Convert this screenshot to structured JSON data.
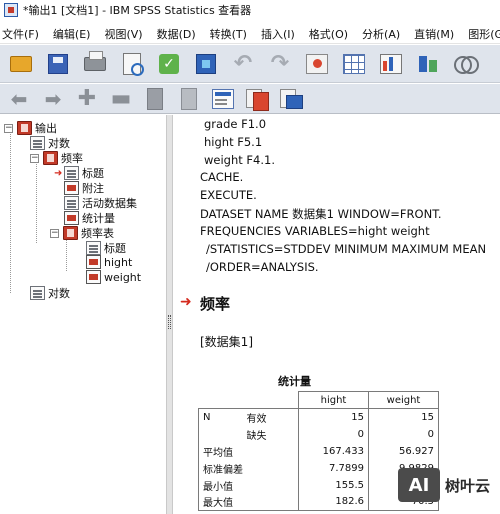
{
  "window": {
    "title": "*输出1 [文档1] - IBM SPSS Statistics 查看器"
  },
  "menu": [
    "文件(F)",
    "编辑(E)",
    "视图(V)",
    "数据(D)",
    "转换(T)",
    "插入(I)",
    "格式(O)",
    "分析(A)",
    "直销(M)",
    "图形(G)"
  ],
  "toolbar1": [
    {
      "name": "open-icon"
    },
    {
      "name": "save-icon"
    },
    {
      "name": "print-icon"
    },
    {
      "name": "print-preview-icon"
    },
    {
      "name": "recall-dialog-icon"
    },
    {
      "name": "export-icon"
    },
    {
      "name": "undo-icon"
    },
    {
      "name": "redo-icon"
    },
    {
      "name": "goto-data-icon"
    },
    {
      "name": "goto-case-icon"
    },
    {
      "name": "variables-icon"
    },
    {
      "name": "charts-icon"
    },
    {
      "name": "use-sets-icon"
    }
  ],
  "toolbar2": [
    {
      "name": "promote-icon"
    },
    {
      "name": "demote-icon"
    },
    {
      "name": "expand-icon"
    },
    {
      "name": "collapse-icon"
    },
    {
      "name": "show-icon"
    },
    {
      "name": "hide-icon"
    },
    {
      "name": "insert-heading-icon"
    },
    {
      "name": "insert-title-icon"
    },
    {
      "name": "insert-text-icon"
    }
  ],
  "outline": {
    "root": "输出",
    "log1": "对数",
    "frequencies": "频率",
    "title": "标题",
    "notes": "附注",
    "active_dataset": "活动数据集",
    "statistics": "统计量",
    "freq_tables": "频率表",
    "freq_title": "标题",
    "hight": "hight",
    "weight": "weight",
    "log2": "对数"
  },
  "syntax": [
    "grade F1.0",
    "hight F5.1",
    "weight F4.1.",
    "CACHE.",
    "EXECUTE.",
    "DATASET NAME 数据集1 WINDOW=FRONT.",
    "FREQUENCIES VARIABLES=hight weight",
    "/STATISTICS=STDDEV MINIMUM MAXIMUM MEAN",
    "/ORDER=ANALYSIS."
  ],
  "content": {
    "section_title": "频率",
    "dataset_label": "[数据集1]",
    "table_caption": "统计量"
  },
  "stats_table": {
    "col_headers": [
      "hight",
      "weight"
    ],
    "rows": [
      {
        "label": "N",
        "sub": "有效",
        "values": [
          "15",
          "15"
        ]
      },
      {
        "label": "",
        "sub": "缺失",
        "values": [
          "0",
          "0"
        ]
      },
      {
        "label": "平均值",
        "sub": "",
        "values": [
          "167.433",
          "56.927"
        ]
      },
      {
        "label": "标准偏差",
        "sub": "",
        "values": [
          "7.7899",
          "9.9829"
        ]
      },
      {
        "label": "最小值",
        "sub": "",
        "values": [
          "155.5",
          "45.2"
        ]
      },
      {
        "label": "最大值",
        "sub": "",
        "values": [
          "182.6",
          "70.5"
        ]
      }
    ]
  },
  "watermark": {
    "badge": "AI",
    "text": "树叶云"
  },
  "colors": {
    "toolbar_bg": "#dfe4ec",
    "accent_red": "#d42a1e",
    "brand_blue": "#2b5aa8"
  }
}
